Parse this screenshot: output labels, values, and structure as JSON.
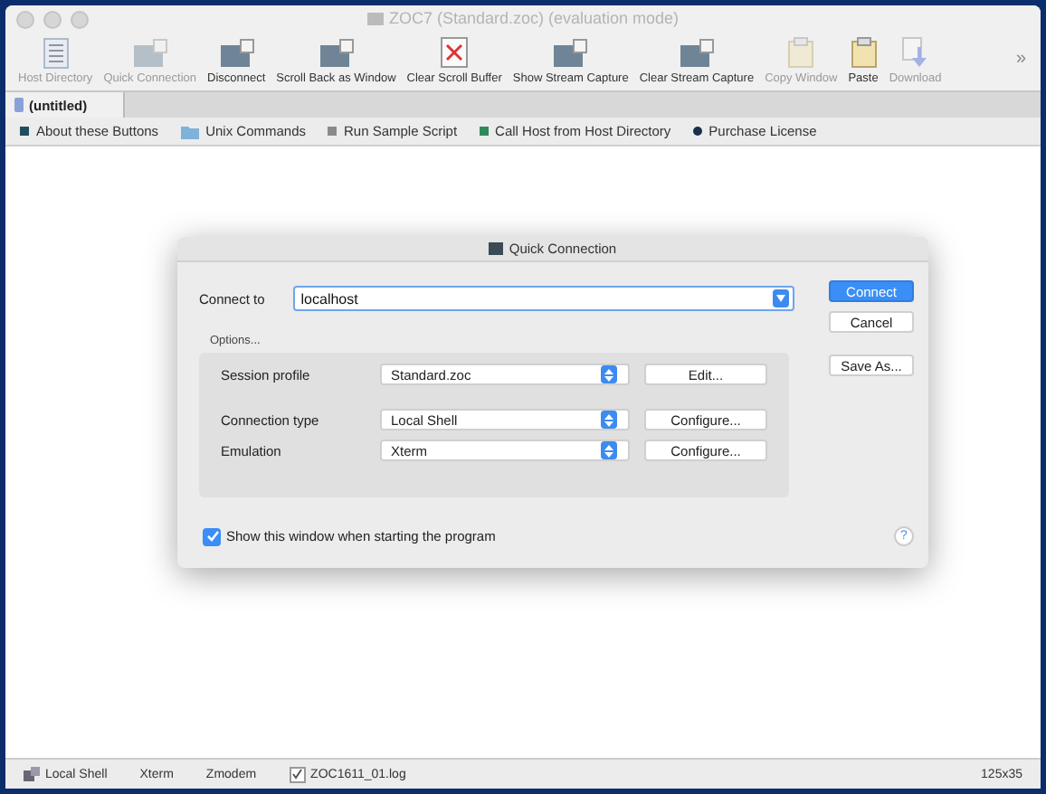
{
  "window": {
    "title": "ZOC7 (Standard.zoc) (evaluation mode)"
  },
  "toolbar": [
    {
      "label": "Host Directory",
      "kind": "list",
      "disabled": true
    },
    {
      "label": "Quick Connection",
      "kind": "monitor",
      "disabled": true
    },
    {
      "label": "Disconnect",
      "kind": "monitor",
      "disabled": false
    },
    {
      "label": "Scroll Back as Window",
      "kind": "monitor",
      "disabled": false
    },
    {
      "label": "Clear Scroll Buffer",
      "kind": "document",
      "disabled": false
    },
    {
      "label": "Show Stream Capture",
      "kind": "monitor",
      "disabled": false
    },
    {
      "label": "Clear Stream Capture",
      "kind": "monitor",
      "disabled": false
    },
    {
      "label": "Copy Window",
      "kind": "clipboard",
      "disabled": true
    },
    {
      "label": "Paste",
      "kind": "clipboard",
      "disabled": false
    },
    {
      "label": "Download",
      "kind": "download",
      "disabled": true
    }
  ],
  "overflow": "»",
  "tabs": [
    {
      "label": "(untitled)",
      "selected": true
    }
  ],
  "buttons": [
    {
      "label": "About these Buttons",
      "kind": "square",
      "color": "#1f4f5c"
    },
    {
      "label": "Unix Commands",
      "kind": "folder",
      "color": "#7fb2d8"
    },
    {
      "label": "Run Sample Script",
      "kind": "square",
      "color": "#8a8a8a"
    },
    {
      "label": "Call Host from Host Directory",
      "kind": "square",
      "color": "#2e8b57"
    },
    {
      "label": "Purchase License",
      "kind": "circle",
      "color": "#1a2f4a"
    }
  ],
  "dialog": {
    "title": "Quick Connection",
    "connect_to": {
      "label": "Connect to",
      "value": "localhost"
    },
    "options_label": "Options...",
    "rows": [
      {
        "label": "Session profile",
        "value": "Standard.zoc",
        "button": "Edit..."
      },
      {
        "label": "Connection type",
        "value": "Local Shell",
        "button": "Configure..."
      },
      {
        "label": "Emulation",
        "value": "Xterm",
        "button": "Configure..."
      }
    ],
    "actions": [
      {
        "label": "Connect",
        "kind": "default"
      },
      {
        "label": "Cancel",
        "kind": "normal"
      },
      {
        "label": "Save As...",
        "kind": "normal"
      }
    ],
    "show_on_start": {
      "label": "Show this window when starting the program",
      "checked": true
    },
    "help": "?"
  },
  "status_bar": {
    "connection": "Local Shell",
    "emulation": "Xterm",
    "transfer": "Zmodem",
    "log": {
      "label": "ZOC1611_01.log",
      "checked": true
    },
    "size": "125x35"
  }
}
